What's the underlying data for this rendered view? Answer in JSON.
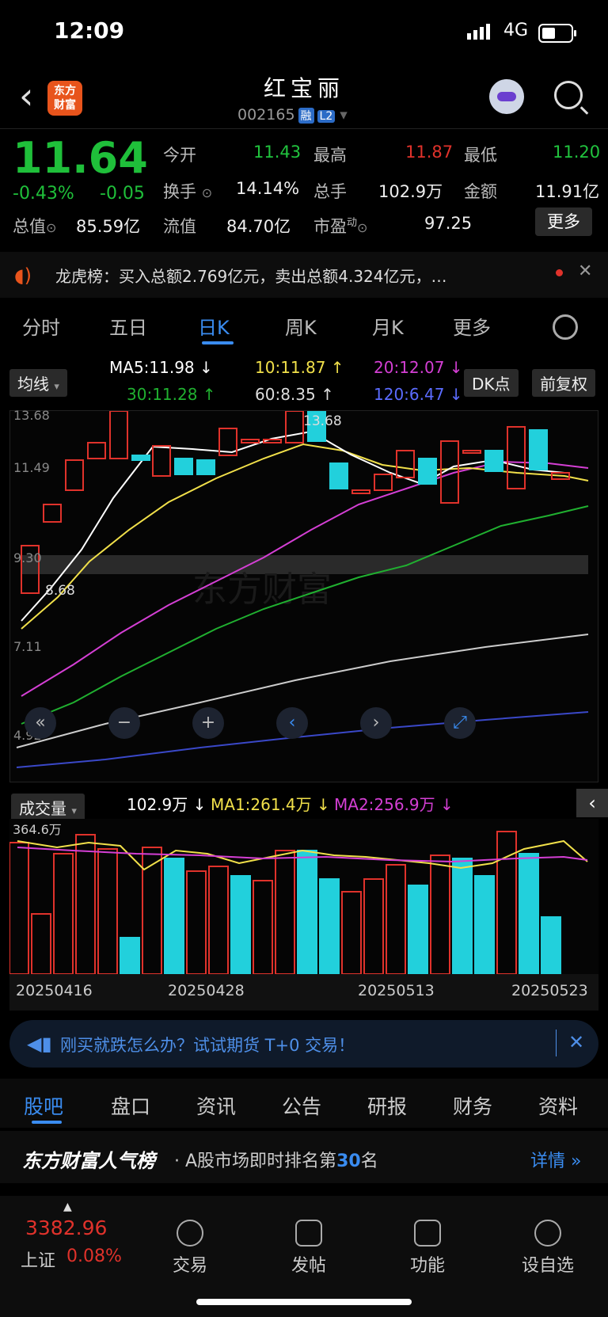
{
  "status": {
    "time": "12:09",
    "network": "4G"
  },
  "header": {
    "back": "‹",
    "logo_line1": "东方",
    "logo_line2": "财富",
    "title": "红宝丽",
    "code": "002165",
    "tag1": "融",
    "tag2": "L2"
  },
  "quote": {
    "price": "11.64",
    "pct": "-0.43%",
    "chg": "-0.05",
    "open_label": "今开",
    "open": "11.43",
    "high_label": "最高",
    "high": "11.87",
    "low_label": "最低",
    "low": "11.20",
    "turnover_label": "换手",
    "turnover": "14.14%",
    "volume_label": "总手",
    "volume": "102.9万",
    "amount_label": "金额",
    "amount": "11.91亿",
    "mcap_label": "总值",
    "mcap": "85.59亿",
    "float_label": "流值",
    "float": "84.70亿",
    "pe_label": "市盈",
    "pe_sup": "动",
    "pe": "97.25",
    "more": "更多"
  },
  "notice": {
    "text": "龙虎榜：买入总额2.769亿元，卖出总额4.324亿元，…"
  },
  "tabs": [
    "分时",
    "五日",
    "日K",
    "周K",
    "月K",
    "更多"
  ],
  "ma": {
    "selector": "均线",
    "ma5": "MA5:11.98",
    "ma10": "10:11.87",
    "ma20": "20:12.07",
    "ma30": "30:11.28",
    "ma60": "60:8.35",
    "ma120": "120:6.47",
    "dk": "DK点",
    "fq": "前复权"
  },
  "chart": {
    "y_labels": [
      "13.68",
      "11.49",
      "9.30",
      "7.11",
      "4.92"
    ],
    "high_mark": "13.68",
    "low_mark": "8.68"
  },
  "colors": {
    "up": "#e0322b",
    "down": "#22d0dc",
    "ma5": "#ffffff",
    "ma10": "#f1e04a",
    "ma20": "#d43fd4",
    "ma30": "#20b030",
    "ma60": "#cccccc",
    "ma120": "#3a48c8"
  },
  "volume": {
    "selector": "成交量",
    "vol": "102.9万",
    "ma1": "MA1:261.4万",
    "ma2": "MA2:256.9万",
    "top": "364.6万"
  },
  "dates": [
    "20250416",
    "20250428",
    "20250513",
    "20250523"
  ],
  "promo": {
    "text": "刚买就跌怎么办？试试期货 T+0 交易！"
  },
  "bottom_tabs": [
    "股吧",
    "盘口",
    "资讯",
    "公告",
    "研报",
    "财务",
    "资料"
  ],
  "rank": {
    "brand": "东方财富人气榜",
    "text_pre": "A股市场即时排名第",
    "num": "30",
    "text_post": "名",
    "detail": "详情"
  },
  "footer": {
    "index_value": "3382.96",
    "index_name": "上证",
    "index_pct": "0.08%",
    "items": [
      "交易",
      "发帖",
      "功能",
      "设自选"
    ]
  }
}
